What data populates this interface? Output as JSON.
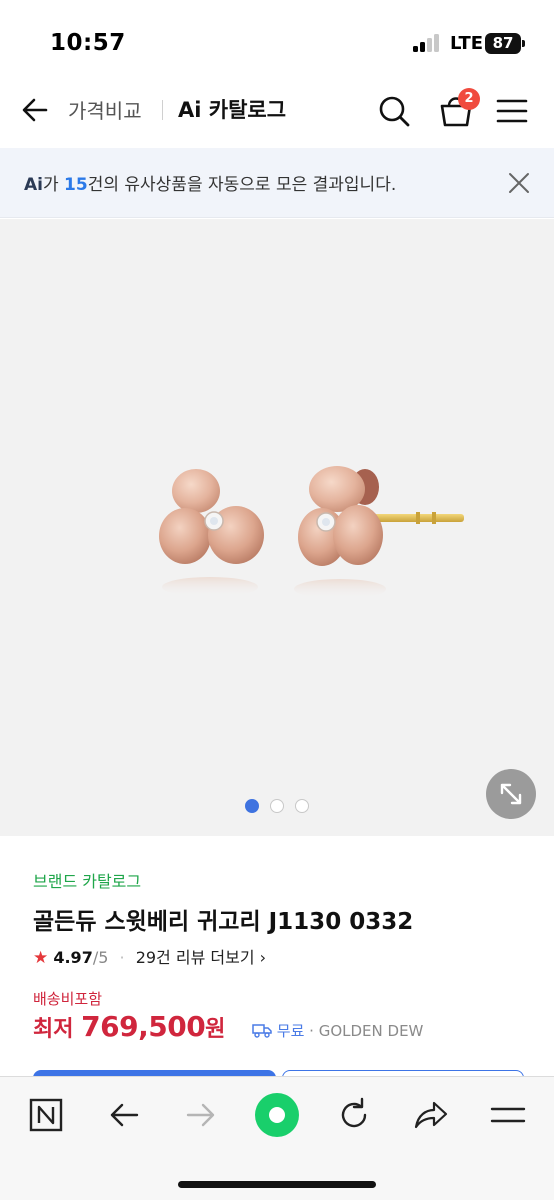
{
  "status_bar": {
    "time": "10:57",
    "carrier": "LTE",
    "battery": "87"
  },
  "nav": {
    "breadcrumb": "가격비교",
    "title": "Ai 카탈로그",
    "cart_count": "2",
    "icons": [
      "back-arrow-icon",
      "search-icon",
      "cart-icon",
      "hamburger-menu-icon"
    ]
  },
  "banner": {
    "ai_label": "Ai",
    "text_prefix": "가 ",
    "count": "15",
    "text_suffix": "건의 유사상품을 자동으로 모은 결과입니다."
  },
  "gallery": {
    "total_images": 3,
    "active_index": 0
  },
  "product": {
    "brand_link": "브랜드 카탈로그",
    "name": "골든듀 스윗베리 귀고리 J1130 0332",
    "rating": "4.97",
    "rating_max": "/5",
    "reviews": "29건 리뷰 더보기",
    "shipping_note": "배송비포함",
    "price_label": "최저 ",
    "price": "769,500",
    "price_unit": "원",
    "free_shipping": "무료",
    "seller": "GOLDEN DEW"
  },
  "colors": {
    "accent_blue": "#3d74e6",
    "price_red": "#d0263d",
    "brand_green": "#1fa64a",
    "badge_red": "#f04b3e",
    "rose_gold": "#e4b39d"
  },
  "toolbar": {
    "icons": [
      "naver-n-icon",
      "browser-back-icon",
      "browser-forward-icon",
      "green-dot-home-icon",
      "reload-icon",
      "share-icon",
      "toolbar-menu-icon"
    ]
  }
}
